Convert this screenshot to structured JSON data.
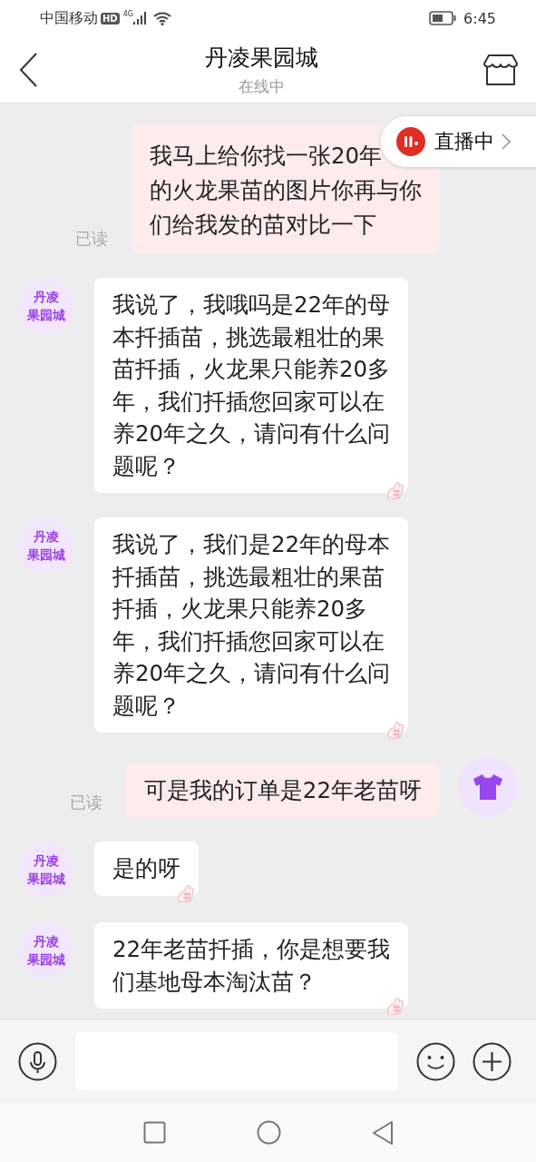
{
  "status_bar": {
    "carrier": "中国移动",
    "hd": "HD",
    "network": "4G",
    "time": "6:45"
  },
  "header": {
    "title": "丹凌果园城",
    "subtitle": "在线中"
  },
  "live_badge": {
    "label": "直播中"
  },
  "messages": [
    {
      "kind": "outgoing",
      "read_label": "已读",
      "lines": [
        "我马上给你找一张20年",
        "的火龙果苗的图片你再与你",
        "们给我发的苗对比一下"
      ],
      "avatar": false
    },
    {
      "kind": "incoming",
      "avatar_text": [
        "丹凌",
        "果园城"
      ],
      "lines": [
        "我说了，我哦吗是22年的母",
        "本扦插苗，挑选最粗壮的果",
        "苗扦插，火龙果只能养20多",
        "年，我们扦插您回家可以在",
        "养20年之久，请问有什么问",
        "题呢？"
      ]
    },
    {
      "kind": "incoming",
      "avatar_text": [
        "丹凌",
        "果园城"
      ],
      "lines": [
        "我说了，我们是22年的母本",
        "扦插苗，挑选最粗壮的果苗",
        "扦插，火龙果只能养20多",
        "年，我们扦插您回家可以在",
        "养20年之久，请问有什么问",
        "题呢？"
      ]
    },
    {
      "kind": "outgoing",
      "read_label": "已读",
      "lines": [
        "可是我的订单是22年老苗呀"
      ],
      "avatar": true
    },
    {
      "kind": "incoming",
      "avatar_text": [
        "丹凌",
        "果园城"
      ],
      "lines": [
        "是的呀"
      ]
    },
    {
      "kind": "incoming",
      "avatar_text": [
        "丹凌",
        "果园城"
      ],
      "lines": [
        "22年老苗扦插，你是想要我",
        "们基地母本淘汰苗？"
      ]
    }
  ]
}
